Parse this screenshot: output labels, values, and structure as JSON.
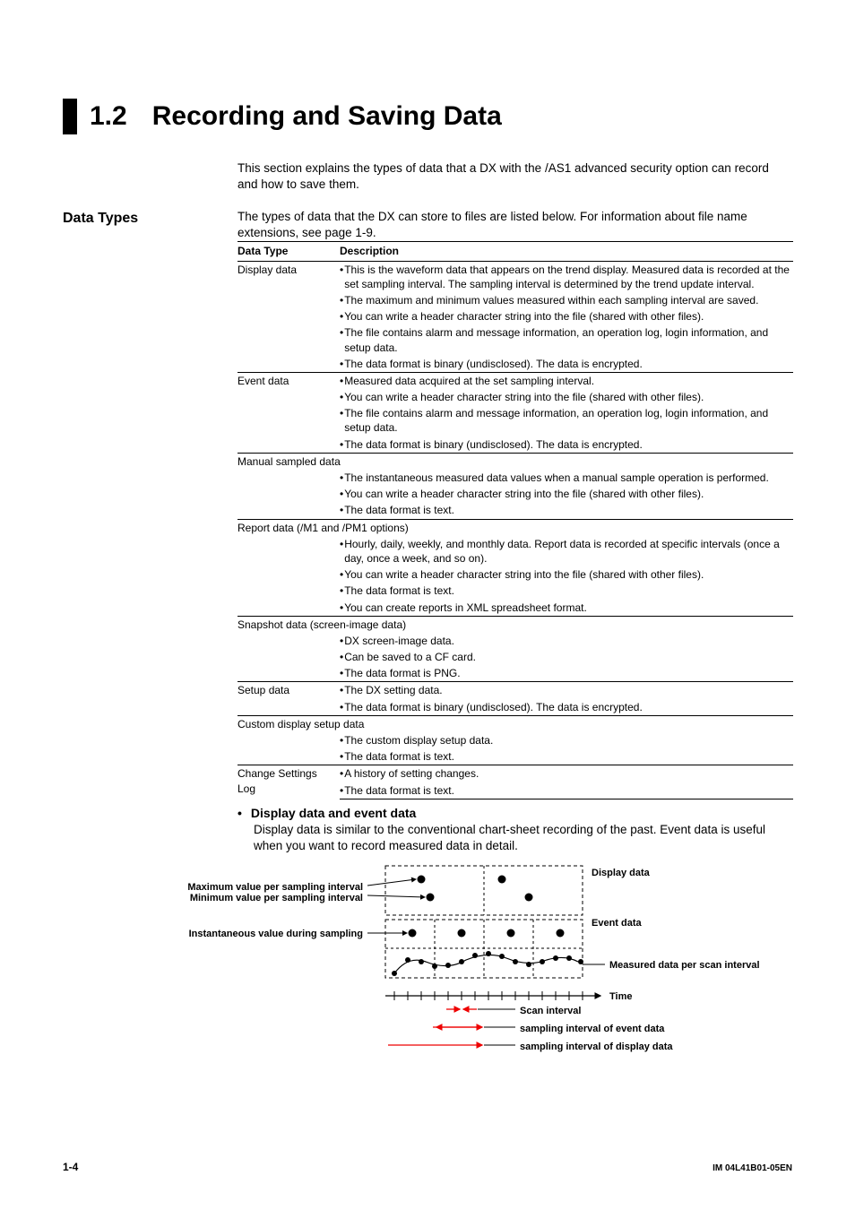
{
  "title": {
    "num": "1.2",
    "text": "Recording and Saving Data"
  },
  "intro": "This section explains the types of data that a DX with the /AS1 advanced security option can record and how to save them.",
  "section": {
    "head": "Data Types",
    "body": "The types of data that the DX can store to files are listed below. For information about file name extensions, see page 1-9."
  },
  "table": {
    "headers": {
      "c1": "Data Type",
      "c2": "Description"
    },
    "rows": [
      {
        "type": "Display data",
        "bullets": [
          "This is the waveform data that appears on the trend display. Measured data is recorded at the set sampling interval. The sampling interval is determined by the trend update interval.",
          "The maximum and minimum values measured within each sampling interval are saved.",
          "You can write a header character string into the file (shared with other files).",
          "The file contains alarm and message information, an operation log, login information, and setup data.",
          "The data format is binary (undisclosed). The data is encrypted."
        ]
      },
      {
        "type": "Event data",
        "bullets": [
          "Measured data acquired at the set sampling interval.",
          "You can write a header character string into the file (shared with other files).",
          "The file contains alarm and message information, an operation log, login information, and setup data.",
          "The data format is binary (undisclosed). The data is encrypted."
        ]
      },
      {
        "type": "Manual sampled data",
        "span": true,
        "bullets": [
          "The instantaneous measured data values when a manual sample operation is performed.",
          "You can write a header character string into the file (shared with other files).",
          "The data format is text."
        ]
      },
      {
        "type": "Report data (/M1 and /PM1 options)",
        "span": true,
        "bullets": [
          "Hourly, daily, weekly, and monthly data. Report data is recorded at specific intervals (once a day, once a week, and so on).",
          "You can write a header character string into the file (shared with other files).",
          "The data format is text.",
          "You can create reports in XML spreadsheet format."
        ]
      },
      {
        "type": "Snapshot data (screen-image data)",
        "span": true,
        "bullets": [
          "DX screen-image data.",
          "Can be saved to a CF card.",
          "The data format is PNG."
        ]
      },
      {
        "type": "Setup data",
        "bullets": [
          "The DX setting data.",
          "The data format is binary (undisclosed). The data is encrypted."
        ]
      },
      {
        "type": "Custom display setup data",
        "span": true,
        "bullets": [
          "The custom display setup data.",
          "The data format is text."
        ]
      },
      {
        "type": "Change Settings Log",
        "bullets": [
          "A history of setting changes.",
          "The data format is text."
        ]
      }
    ]
  },
  "sub": {
    "head": "Display data and event data",
    "body": "Display data is similar to the conventional chart-sheet recording of the past. Event data is useful when you want to record measured data in detail."
  },
  "diagram": {
    "l_max": "Maximum value per sampling interval",
    "l_min": "Minimum value per sampling interval",
    "l_inst": "Instantaneous value during sampling",
    "r_disp": "Display data",
    "r_evt": "Event data",
    "r_meas": "Measured data per scan interval",
    "r_time": "Time",
    "r_scan": "Scan interval",
    "r_sevt": "sampling interval of event data",
    "r_sdisp": "sampling interval of display data"
  },
  "footer": {
    "left": "1-4",
    "right": "IM 04L41B01-05EN"
  }
}
